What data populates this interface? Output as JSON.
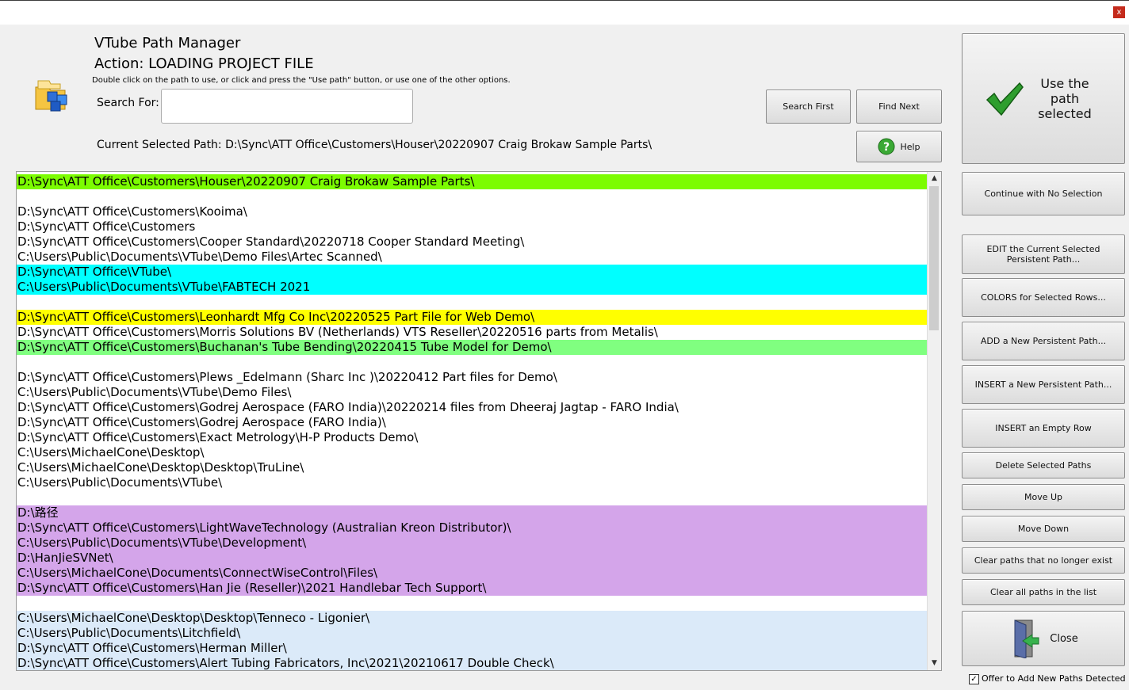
{
  "window": {
    "close_glyph": "x"
  },
  "header": {
    "app_title": "VTube Path Manager",
    "action": "Action: LOADING PROJECT FILE",
    "hint": "Double click on the path to use, or click and press the \"Use path\" button, or use one of the other options.",
    "search_label": "Search For:",
    "search_value": "",
    "current_path_label": "Current Selected Path:",
    "current_path_value": "D:\\Sync\\ATT Office\\Customers\\Houser\\20220907 Craig Brokaw Sample Parts\\"
  },
  "buttons": {
    "search_first": "Search First",
    "find_next": "Find Next",
    "help": "Help",
    "use_path": "Use the path selected",
    "continue": "Continue with No Selection",
    "edit": "EDIT the Current Selected Persistent Path...",
    "colors": "COLORS for Selected Rows...",
    "add": "ADD a New Persistent Path...",
    "insert": "INSERT a New Persistent Path...",
    "insert_empty": "INSERT an Empty Row",
    "delete": "Delete Selected Paths",
    "move_up": "Move Up",
    "move_down": "Move Down",
    "clear_missing": "Clear paths that no longer exist",
    "clear_all": "Clear all paths in the list",
    "close": "Close"
  },
  "offer_checkbox": {
    "label": "Offer to Add New Paths Detected",
    "checked": true
  },
  "colors": {
    "green": "#7cfc00",
    "cyan": "#00ffff",
    "yellow": "#ffff00",
    "light_green": "#80ff80",
    "purple": "#d4a5ea",
    "light_blue": "#dbeaf9",
    "white": "#ffffff"
  },
  "paths": [
    {
      "text": "D:\\Sync\\ATT Office\\Customers\\Houser\\20220907 Craig Brokaw Sample Parts\\",
      "color": "green"
    },
    {
      "text": "",
      "color": "white"
    },
    {
      "text": "D:\\Sync\\ATT Office\\Customers\\Kooima\\",
      "color": "white"
    },
    {
      "text": "D:\\Sync\\ATT Office\\Customers",
      "color": "white"
    },
    {
      "text": "D:\\Sync\\ATT Office\\Customers\\Cooper Standard\\20220718 Cooper Standard Meeting\\",
      "color": "white"
    },
    {
      "text": "C:\\Users\\Public\\Documents\\VTube\\Demo Files\\Artec Scanned\\",
      "color": "white"
    },
    {
      "text": "D:\\Sync\\ATT Office\\VTube\\",
      "color": "cyan"
    },
    {
      "text": "C:\\Users\\Public\\Documents\\VTube\\FABTECH 2021",
      "color": "cyan"
    },
    {
      "text": "",
      "color": "white"
    },
    {
      "text": "D:\\Sync\\ATT Office\\Customers\\Leonhardt Mfg Co Inc\\20220525 Part File for Web Demo\\",
      "color": "yellow"
    },
    {
      "text": "D:\\Sync\\ATT Office\\Customers\\Morris Solutions BV (Netherlands) VTS Reseller\\20220516 parts from Metalis\\",
      "color": "white"
    },
    {
      "text": "D:\\Sync\\ATT Office\\Customers\\Buchanan's Tube Bending\\20220415 Tube Model for Demo\\",
      "color": "light_green"
    },
    {
      "text": "",
      "color": "white"
    },
    {
      "text": "D:\\Sync\\ATT Office\\Customers\\Plews _Edelmann (Sharc Inc )\\20220412 Part files for Demo\\",
      "color": "white"
    },
    {
      "text": "C:\\Users\\Public\\Documents\\VTube\\Demo Files\\",
      "color": "white"
    },
    {
      "text": "D:\\Sync\\ATT Office\\Customers\\Godrej Aerospace (FARO India)\\20220214 files from Dheeraj Jagtap - FARO India\\",
      "color": "white"
    },
    {
      "text": "D:\\Sync\\ATT Office\\Customers\\Godrej Aerospace (FARO India)\\",
      "color": "white"
    },
    {
      "text": "D:\\Sync\\ATT Office\\Customers\\Exact Metrology\\H-P Products Demo\\",
      "color": "white"
    },
    {
      "text": "C:\\Users\\MichaelCone\\Desktop\\",
      "color": "white"
    },
    {
      "text": "C:\\Users\\MichaelCone\\Desktop\\Desktop\\TruLine\\",
      "color": "white"
    },
    {
      "text": "C:\\Users\\Public\\Documents\\VTube\\",
      "color": "white"
    },
    {
      "text": "",
      "color": "white"
    },
    {
      "text": "D:\\路径",
      "color": "purple"
    },
    {
      "text": "D:\\Sync\\ATT Office\\Customers\\LightWaveTechnology (Australian Kreon Distributor)\\",
      "color": "purple"
    },
    {
      "text": "C:\\Users\\Public\\Documents\\VTube\\Development\\",
      "color": "purple"
    },
    {
      "text": "D:\\HanJieSVNet\\",
      "color": "purple"
    },
    {
      "text": "C:\\Users\\MichaelCone\\Documents\\ConnectWiseControl\\Files\\",
      "color": "purple"
    },
    {
      "text": "D:\\Sync\\ATT Office\\Customers\\Han Jie (Reseller)\\2021 Handlebar Tech Support\\",
      "color": "purple"
    },
    {
      "text": "",
      "color": "white"
    },
    {
      "text": "C:\\Users\\MichaelCone\\Desktop\\Desktop\\Tenneco - Ligonier\\",
      "color": "light_blue"
    },
    {
      "text": "C:\\Users\\Public\\Documents\\Litchfield\\",
      "color": "light_blue"
    },
    {
      "text": "D:\\Sync\\ATT Office\\Customers\\Herman Miller\\",
      "color": "light_blue"
    },
    {
      "text": "D:\\Sync\\ATT Office\\Customers\\Alert Tubing Fabricators, Inc\\2021\\20210617 Double Check\\",
      "color": "light_blue"
    }
  ],
  "icons": {
    "app": "folder-blocks-icon",
    "use": "checkmark-icon",
    "help": "help-icon",
    "close": "exit-door-icon",
    "scroll_up": "▲",
    "scroll_down": "▼",
    "check": "✓"
  }
}
